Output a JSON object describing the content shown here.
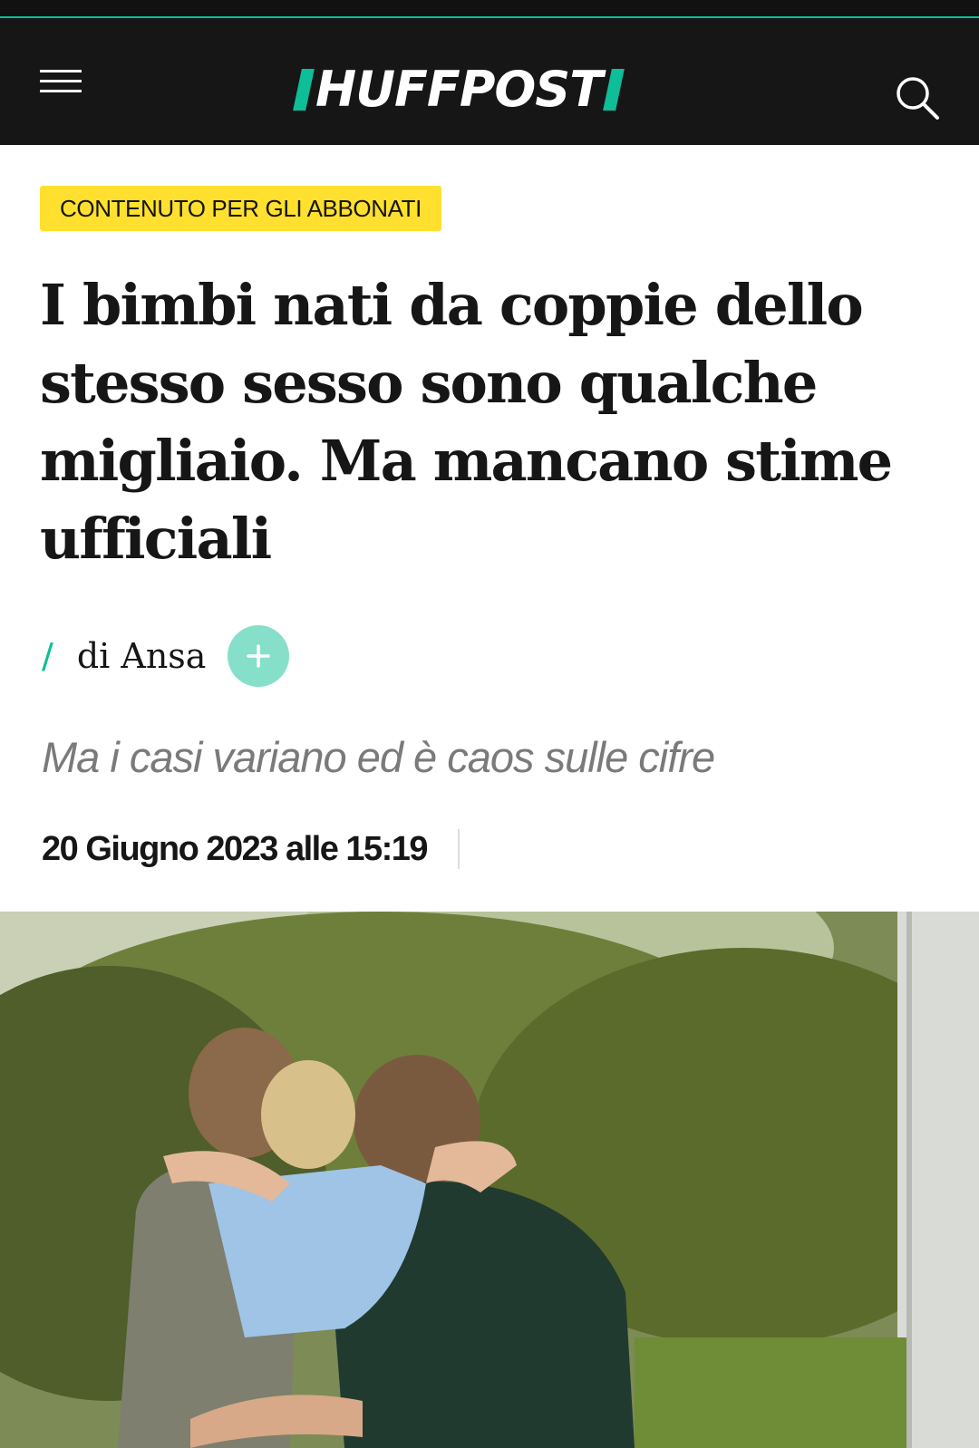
{
  "header": {
    "logo_text": "HUFFPOST",
    "menu_icon": "hamburger-menu-icon",
    "search_icon": "search-icon",
    "accent_color": "#0dbe98",
    "background_color": "#161616"
  },
  "article": {
    "badge": "CONTENUTO PER GLI ABBONATI",
    "badge_color": "#ffe02e",
    "headline": "I bimbi nati da coppie dello stesso sesso sono qualche migliaio. Ma mancano stime ufficiali",
    "byline_prefix": "/",
    "author": "di Ansa",
    "follow_icon": "plus-icon",
    "subtitle": "Ma i casi variano ed è caos sulle cifre",
    "date": "20 Giugno 2023 alle 15:19"
  },
  "hero_image": {
    "icon": "photo"
  }
}
